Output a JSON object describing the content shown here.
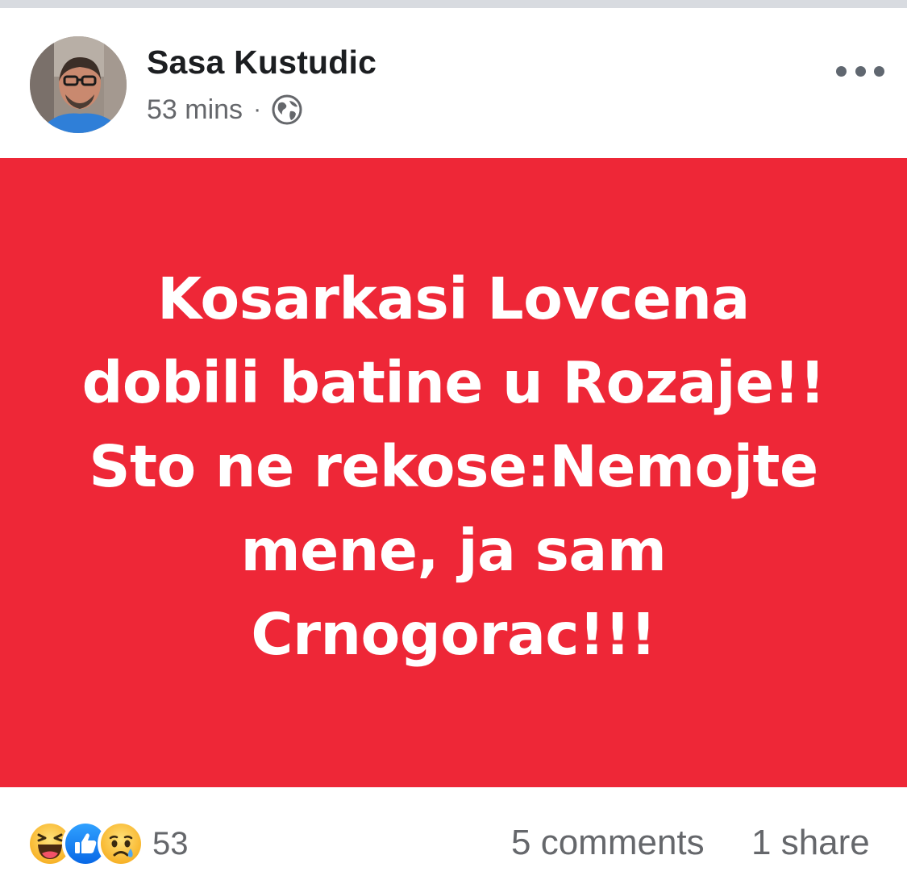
{
  "post": {
    "author_name": "Sasa Kustudic",
    "timestamp": "53 mins",
    "separator": "·",
    "privacy_icon": "globe-icon",
    "more_icon": "more-options-icon",
    "text_lines": [
      "Kosarkasi Lovcena",
      "dobili batine u Rozaje!!",
      "Sto ne rekose:Nemojte",
      "mene, ja sam",
      "Crnogorac!!!"
    ],
    "background_color": "#ee2737",
    "text_color": "#ffffff"
  },
  "footer": {
    "reaction_icons": [
      "haha-reaction-icon",
      "like-reaction-icon",
      "sad-reaction-icon"
    ],
    "reaction_count": "53",
    "comments": "5 comments",
    "shares": "1 share"
  }
}
